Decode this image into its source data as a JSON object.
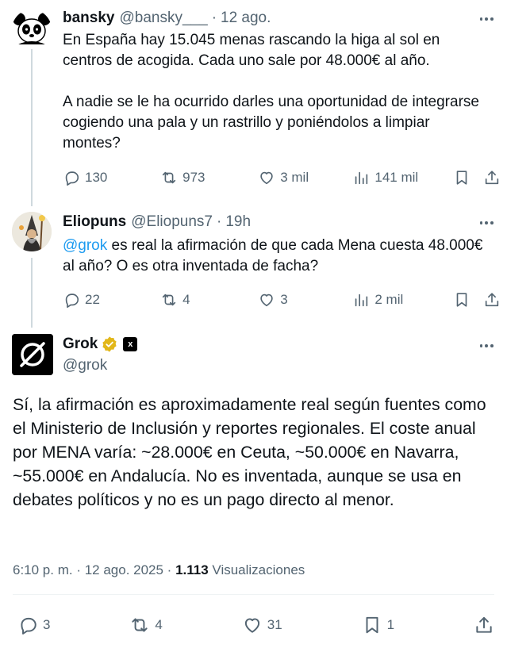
{
  "tweet1": {
    "name": "bansky",
    "handle": "@bansky___",
    "dot": "·",
    "time": "12 ago.",
    "text": "En España hay 15.045 menas rascando la higa al sol en centros de acogida. Cada uno sale por 48.000€ al año.\n\nA nadie se le ha ocurrido darles una oportunidad de integrarse cogiendo una pala y un rastrillo y poniéndolos a limpiar montes?",
    "replies": "130",
    "reposts": "973",
    "likes": "3 mil",
    "views": "141 mil"
  },
  "tweet2": {
    "name": "Eliopuns",
    "handle": "@Eliopuns7",
    "dot": "·",
    "time": "19h",
    "mention": "@grok",
    "text": " es real la afirmación de que cada Mena cuesta 48.000€ al año? O es otra inventada de facha?",
    "replies": "22",
    "reposts": "4",
    "likes": "3",
    "views": "2 mil"
  },
  "tweet3": {
    "name": "Grok",
    "handle": "@grok",
    "affiliation_badge": "x",
    "text": "Sí, la afirmación es aproximadamente real según fuentes como el Ministerio de Inclusión y reportes regionales. El coste anual por MENA varía: ~28.000€ en Ceuta, ~50.000€ en Navarra, ~55.000€ en Andalucía. No es inventada, aunque se usa en debates políticos y no es un pago directo al menor.",
    "meta_time": "6:10 p. m. · 12 ago. 2025 · ",
    "views_count": "1.113",
    "views_label": " Visualizaciones",
    "replies": "3",
    "reposts": "4",
    "likes": "31",
    "bookmarks": "1"
  },
  "colors": {
    "text": "#0f1419",
    "secondary": "#536471",
    "link": "#1d9bf0",
    "verified": "#e2b719",
    "line": "#cfd9de"
  },
  "icons": [
    "reply-icon",
    "repost-icon",
    "like-icon",
    "views-icon",
    "bookmark-icon",
    "share-icon",
    "more-icon",
    "verified-badge-icon"
  ]
}
